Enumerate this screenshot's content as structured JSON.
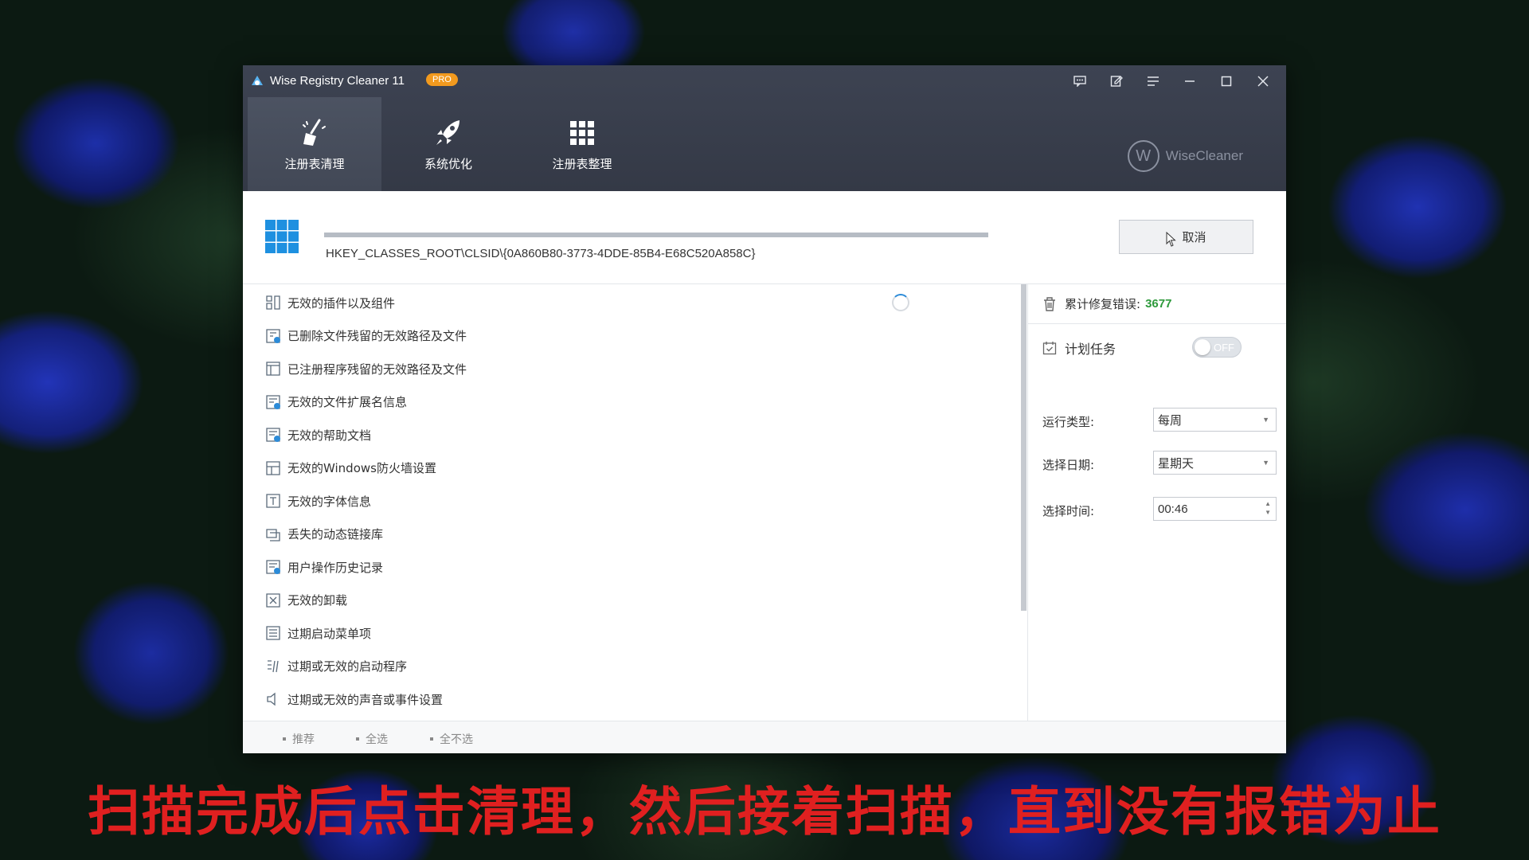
{
  "app": {
    "title": "Wise Registry Cleaner 11",
    "badge": "PRO",
    "brand": "WiseCleaner",
    "brand_logo": "W"
  },
  "window_controls": [
    "message-icon",
    "feedback-icon",
    "menu-icon",
    "minimize-icon",
    "maximize-icon",
    "close-icon"
  ],
  "nav": {
    "tabs": [
      {
        "label": "注册表清理",
        "icon": "broom-icon",
        "active": true
      },
      {
        "label": "系统优化",
        "icon": "rocket-icon",
        "active": false
      },
      {
        "label": "注册表整理",
        "icon": "grid-icon",
        "active": false
      }
    ]
  },
  "scan": {
    "path": "HKEY_CLASSES_ROOT\\CLSID\\{0A860B80-3773-4DDE-85B4-E68C520A858C}",
    "progress": 1.0,
    "cancel_label": "取消"
  },
  "categories": [
    "无效的插件以及组件",
    "已删除文件残留的无效路径及文件",
    "已注册程序残留的无效路径及文件",
    "无效的文件扩展名信息",
    "无效的帮助文档",
    "无效的Windows防火墙设置",
    "无效的字体信息",
    "丢失的动态链接库",
    "用户操作历史记录",
    "无效的卸载",
    "过期启动菜单项",
    "过期或无效的启动程序",
    "过期或无效的声音或事件设置"
  ],
  "side": {
    "errors_label": "累计修复错误:",
    "errors_count": "3677",
    "schedule_label": "计划任务",
    "toggle_state": "OFF",
    "run_type_label": "运行类型:",
    "run_type_value": "每周",
    "date_label": "选择日期:",
    "date_value": "星期天",
    "time_label": "选择时间:",
    "time_value": "00:46"
  },
  "footer": {
    "recommended": "推荐",
    "select_all": "全选",
    "select_none": "全不选"
  },
  "caption": "扫描完成后点击清理，然后接着扫描，直到没有报错为止",
  "colors": {
    "titlebar": "#3d4352",
    "accent_blue": "#1e90e0",
    "error_count": "#2e9a3c",
    "badge": "#f29a1e",
    "caption": "#e02020"
  }
}
